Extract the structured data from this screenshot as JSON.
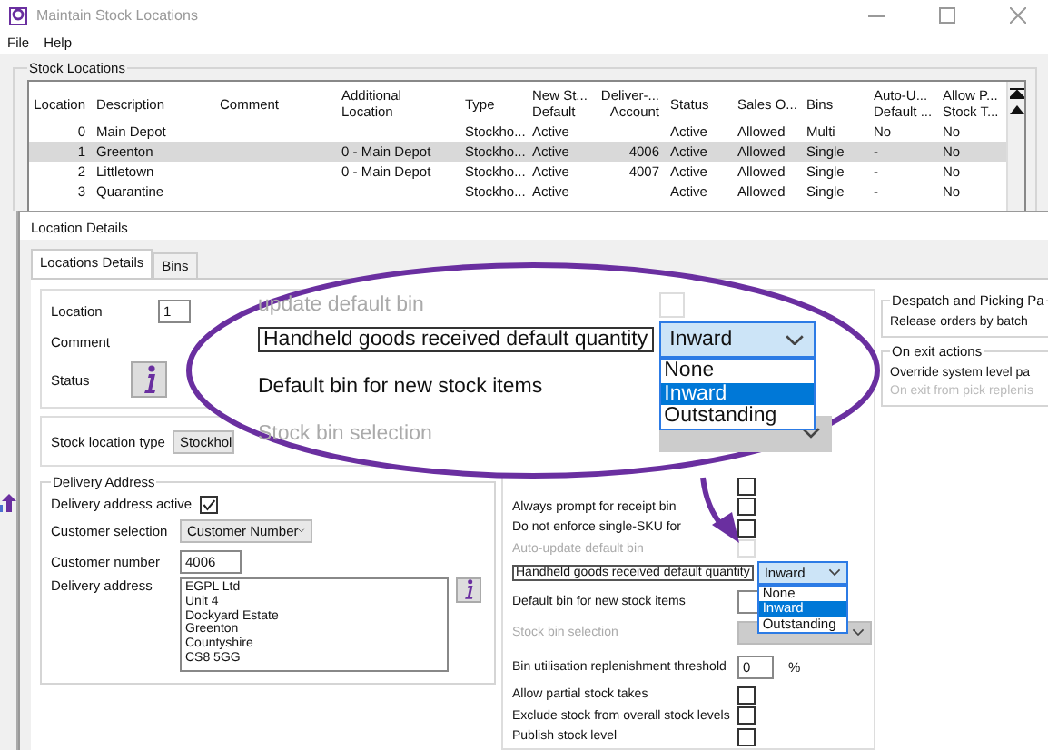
{
  "window": {
    "title": "Maintain Stock Locations"
  },
  "menu": [
    "File",
    "Help"
  ],
  "stock_locations": {
    "title": "Stock Locations",
    "columns": [
      "Location",
      "Description",
      "Comment",
      "Additional\nLocation",
      "Type",
      "New St...\nDefault",
      "Deliver-...\nAccount",
      "Status",
      "Sales O...",
      "Bins",
      "Auto-U...\nDefault ...",
      "Allow P...\nStock T..."
    ],
    "rows": [
      {
        "selected": false,
        "cells": [
          "0",
          "Main Depot",
          null,
          null,
          "Stockho...",
          "Active",
          null,
          "Active",
          "Allowed",
          "Multi",
          "No",
          "No"
        ]
      },
      {
        "selected": true,
        "cells": [
          "1",
          "Greenton",
          null,
          "0 - Main Depot",
          "Stockho...",
          "Active",
          "4006",
          "Active",
          "Allowed",
          "Single",
          "-",
          "No"
        ]
      },
      {
        "selected": false,
        "cells": [
          "2",
          "Littletown",
          null,
          "0 - Main Depot",
          "Stockho...",
          "Active",
          "4007",
          "Active",
          "Allowed",
          "Single",
          "-",
          "No"
        ]
      },
      {
        "selected": false,
        "cells": [
          "3",
          "Quarantine",
          null,
          null,
          "Stockho...",
          "Active",
          null,
          "Active",
          "Allowed",
          "Single",
          "-",
          "No"
        ]
      }
    ]
  },
  "location_details": {
    "title": "Location Details",
    "tabs": [
      {
        "label": "Locations Details",
        "selected": true
      },
      {
        "label": "Bins",
        "selected": false
      }
    ],
    "location": {
      "label": "Location",
      "value": "1"
    },
    "comment_label": "Comment",
    "status_label": "Status",
    "stock_location_type": {
      "label": "Stock location type",
      "value": "Stockhol"
    },
    "delivery": {
      "title": "Delivery Address",
      "active": {
        "label": "Delivery address active",
        "checked": true
      },
      "customer_selection": {
        "label": "Customer selection",
        "value": "Customer Number"
      },
      "customer_number": {
        "label": "Customer number",
        "value": "4006"
      },
      "address": {
        "label": "Delivery address",
        "lines": [
          "EGPL Ltd",
          "Unit 4",
          "Dockyard Estate",
          "Greenton",
          "Countyshire",
          "CS8 5GG"
        ]
      }
    },
    "bin_settings": [
      {
        "kind": "checkbox",
        "checked": false,
        "disabled": false
      },
      {
        "kind": "checkbox",
        "label": "Always prompt for receipt bin",
        "checked": false,
        "disabled": false
      },
      {
        "kind": "checkbox",
        "label": "Do not enforce single-SKU for",
        "checked": false,
        "disabled": false
      },
      {
        "kind": "checkbox",
        "label": "Auto-update default bin",
        "checked": false,
        "disabled": true
      },
      {
        "kind": "select",
        "label": "Handheld goods received default quantity",
        "value": "Inward",
        "highlighted": true,
        "disabled": false,
        "options": [
          {
            "label": "None",
            "selected": false
          },
          {
            "label": "Inward",
            "selected": true
          },
          {
            "label": "Outstanding",
            "selected": false
          }
        ]
      },
      {
        "kind": "field",
        "label": "Default bin for new stock items",
        "disabled": false
      },
      {
        "kind": "select",
        "label": "Stock bin selection",
        "highlighted": false,
        "disabled": true
      },
      {
        "kind": "field",
        "label": "Bin utilisation replenishment threshold",
        "value": "0",
        "unit": "%",
        "disabled": false
      },
      {
        "kind": "checkbox",
        "label": "Allow partial stock takes",
        "checked": false,
        "disabled": false
      },
      {
        "kind": "checkbox",
        "label": "Exclude stock from overall stock levels",
        "checked": false,
        "disabled": false
      },
      {
        "kind": "checkbox",
        "label": "Publish stock level",
        "checked": false,
        "disabled": false
      }
    ],
    "right_groups": [
      {
        "title": "Despatch and Picking Pa",
        "items": [
          {
            "label": "Release orders by batch",
            "disabled": false
          }
        ]
      },
      {
        "title": "On exit actions",
        "items": [
          {
            "label": "Override system level pa",
            "disabled": false
          },
          {
            "label": "On exit from pick replenis",
            "disabled": true
          }
        ]
      }
    ]
  },
  "callout": {
    "rows": [
      {
        "kind": "checkbox",
        "label": "update default bin",
        "checked": false,
        "disabled": true
      },
      {
        "kind": "select",
        "label": "Handheld goods received default quantity",
        "value": "Inward",
        "highlighted": true,
        "disabled": false,
        "options": [
          {
            "label": "None",
            "selected": false
          },
          {
            "label": "Inward",
            "selected": true
          },
          {
            "label": "Outstanding",
            "selected": false
          }
        ]
      },
      {
        "kind": "field",
        "label": "Default bin for new stock items",
        "disabled": false
      },
      {
        "kind": "select",
        "label": "Stock bin selection",
        "highlighted": false,
        "disabled": true
      }
    ]
  }
}
